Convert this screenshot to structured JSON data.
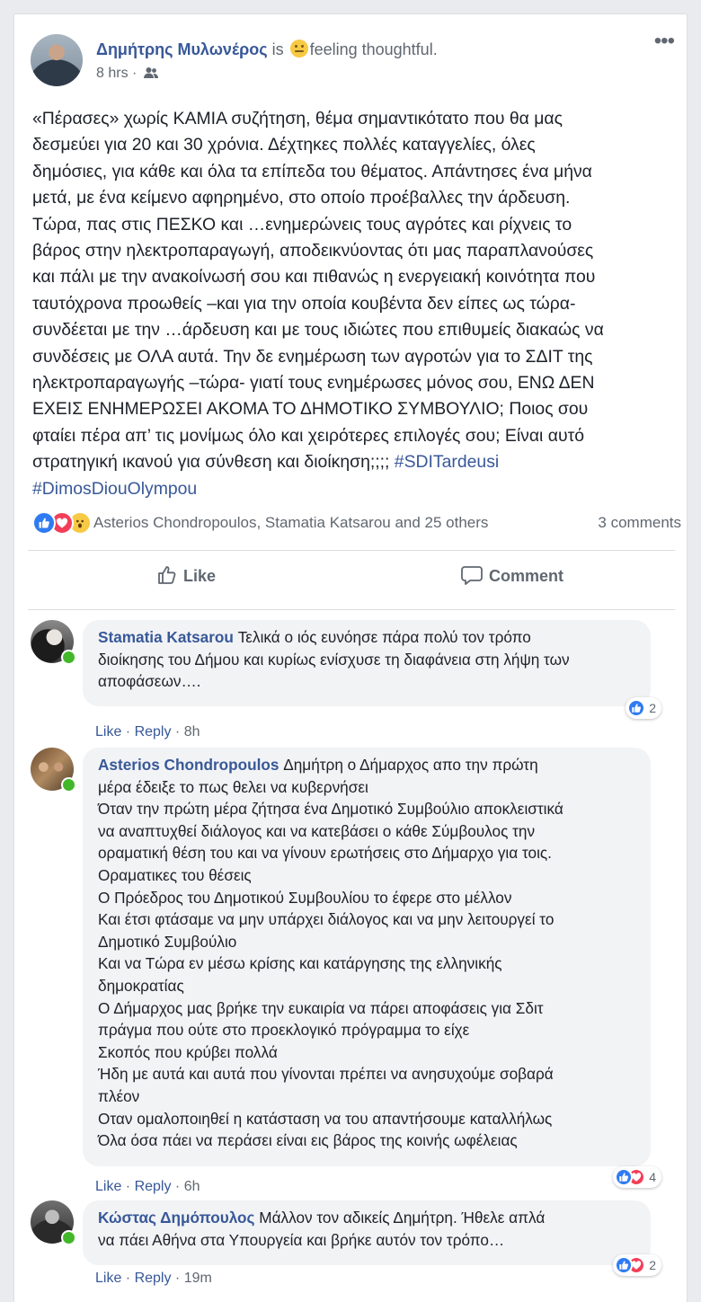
{
  "post": {
    "author": "Δημήτρης Μυλωνέρος",
    "is_text": " is ",
    "feeling_text": "feeling thoughtful.",
    "feeling_icon": "thinking-face-emoji",
    "time": "8 hrs",
    "meta_separator": " · ",
    "audience_icon": "friends-audience-icon",
    "more_label": "•••",
    "text": "«Πέρασες» χωρίς ΚΑΜΙΑ συζήτηση, θέμα σημαντικότατο που θα μας\nδεσμεύει για 20 και 30 χρόνια. Δέχτηκες πολλές καταγγελίες, όλες\nδημόσιες, για κάθε και όλα τα επίπεδα του θέματος. Απάντησες ένα μήνα\nμετά, με ένα κείμενο αφηρημένο, στο οποίο προέβαλλες την άρδευση.\nΤώρα, πας στις ΠΕΣΚΟ και …ενημερώνεις τους αγρότες και ρίχνεις το\nβάρος στην ηλεκτροπαραγωγή, αποδεικνύοντας ότι μας παραπλανούσες\nκαι πάλι με την ανακοίνωσή σου και πιθανώς η ενεργειακή κοινότητα που\nταυτόχρονα προωθείς –και για την οποία κουβέντα δεν είπες ως τώρα-\nσυνδέεται με την …άρδευση και με τους ιδιώτες που επιθυμείς διακαώς να\nσυνδέσεις με ΟΛΑ αυτά. Την δε ενημέρωση των αγροτών για το ΣΔΙΤ της\nηλεκτροπαραγωγής –τώρα- γιατί τους ενημέρωσες μόνος σου, ΕΝΩ ΔΕΝ\nΕΧΕΙΣ ΕΝΗΜΕΡΩΣΕΙ ΑΚΟΜΑ ΤΟ ΔΗΜΟΤΙΚΟ ΣΥΜΒΟΥΛΙΟ; Ποιος σου\nφταίει πέρα απ’ τις μονίμως όλο και χειρότερες επιλογές σου; Είναι αυτό\nστρατηγική ικανού για σύνθεση και διοίκηση;;;; ",
    "hashtags": [
      "#SDITardeusi",
      "#DimosDiouOlympou"
    ],
    "reactions_icons": [
      "like",
      "love",
      "wow"
    ],
    "reactions_text": "Asterios Chondropoulos, Stamatia Katsarou and 25 others",
    "comments_count": "3 comments",
    "like_label": "Like",
    "comment_label": "Comment"
  },
  "comments": [
    {
      "name": "Stamatia Katsarou",
      "text": "Τελικά ο ιός ευνόησε πάρα πολύ τον τρόπο\nδιοίκησης του Δήμου και κυρίως ενίσχυσε τη διαφάνεια στη λήψη των\nαποφάσεων….",
      "like": "Like",
      "reply": "Reply",
      "sep": " · ",
      "time": "8h",
      "reaction_count": "2",
      "reaction_types": [
        "like"
      ]
    },
    {
      "name": "Asterios Chondropoulos",
      "text": "Δημήτρη ο Δήμαρχος απο την πρώτη\nμέρα έδειξε το πως θελει να κυβερνήσει\nΌταν την πρώτη μέρα ζήτησα ένα Δημοτικό Συμβούλιο αποκλειστικά\nνα αναπτυχθεί διάλογος και να κατεβάσει ο κάθε Σύμβουλος την\nοραματική θέση του και να γίνουν ερωτήσεις στο Δήμαρχο για τοις.\nΟραματικες του θέσεις\nΟ Πρόεδρος του Δημοτικού Συμβουλίου το έφερε στο μέλλον\nΚαι έτσι φτάσαμε να μην υπάρχει διάλογος και να μην λειτουργεί το\nΔημοτικό Συμβούλιο\nΚαι να Τώρα εν μέσω κρίσης και κατάργησης της ελληνικής\nδημοκρατίας\nΟ Δήμαρχος μας βρήκε την ευκαιρία να πάρει αποφάσεις για Σδιτ\nπράγμα που ούτε στο προεκλογικό πρόγραμμα το είχε\nΣκοπός που κρύβει πολλά\nΉδη με αυτά και αυτά που γίνονται πρέπει να ανησυχούμε σοβαρά\nπλέον\nΟταν ομαλοποιηθεί η κατάσταση να του απαντήσουμε καταλλήλως\nΌλα όσα πάει να περάσει είναι εις βάρος της κοινής ωφέλειας",
      "like": "Like",
      "reply": "Reply",
      "sep": " · ",
      "time": "6h",
      "reaction_count": "4",
      "reaction_types": [
        "like",
        "love"
      ]
    },
    {
      "name": "Κώστας Δημόπουλος",
      "text": "Μάλλον τον αδικείς Δημήτρη. Ήθελε απλά\nνα πάει Αθήνα στα Υπουργεία και βρήκε αυτόν τον τρόπο…",
      "like": "Like",
      "reply": "Reply",
      "sep": " · ",
      "time": "19m",
      "reaction_count": "2",
      "reaction_types": [
        "like",
        "love"
      ]
    }
  ]
}
